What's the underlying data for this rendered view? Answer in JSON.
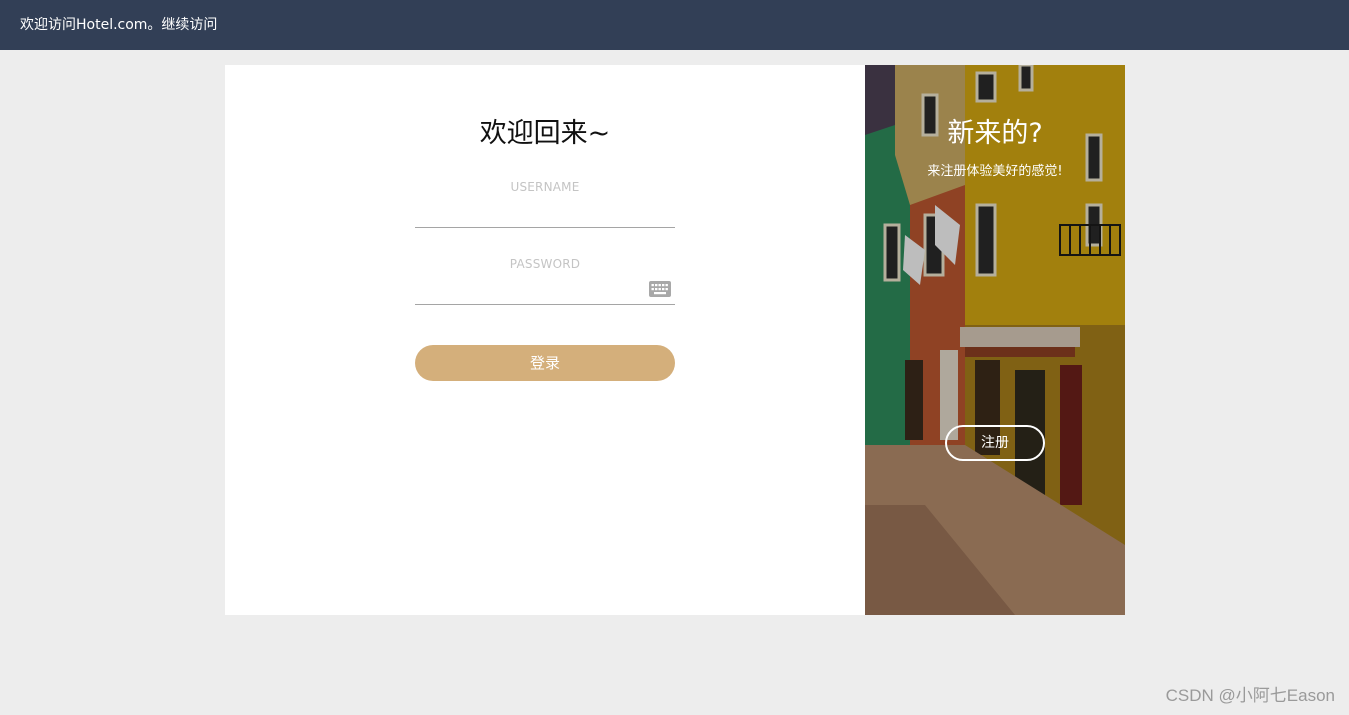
{
  "header": {
    "welcome_text": "欢迎访问Hotel.com。继续访问"
  },
  "login_form": {
    "title": "欢迎回来~",
    "username": {
      "label": "USERNAME",
      "value": ""
    },
    "password": {
      "label": "PASSWORD",
      "value": "",
      "icon": "keyboard-icon"
    },
    "submit_label": "登录"
  },
  "register_panel": {
    "title": "新来的?",
    "subtitle": "来注册体验美好的感觉!",
    "button_label": "注册"
  },
  "watermark": "CSDN @小阿七Eason",
  "colors": {
    "header_bg": "#323f56",
    "page_bg": "#ededed",
    "accent": "#d4af7b"
  }
}
